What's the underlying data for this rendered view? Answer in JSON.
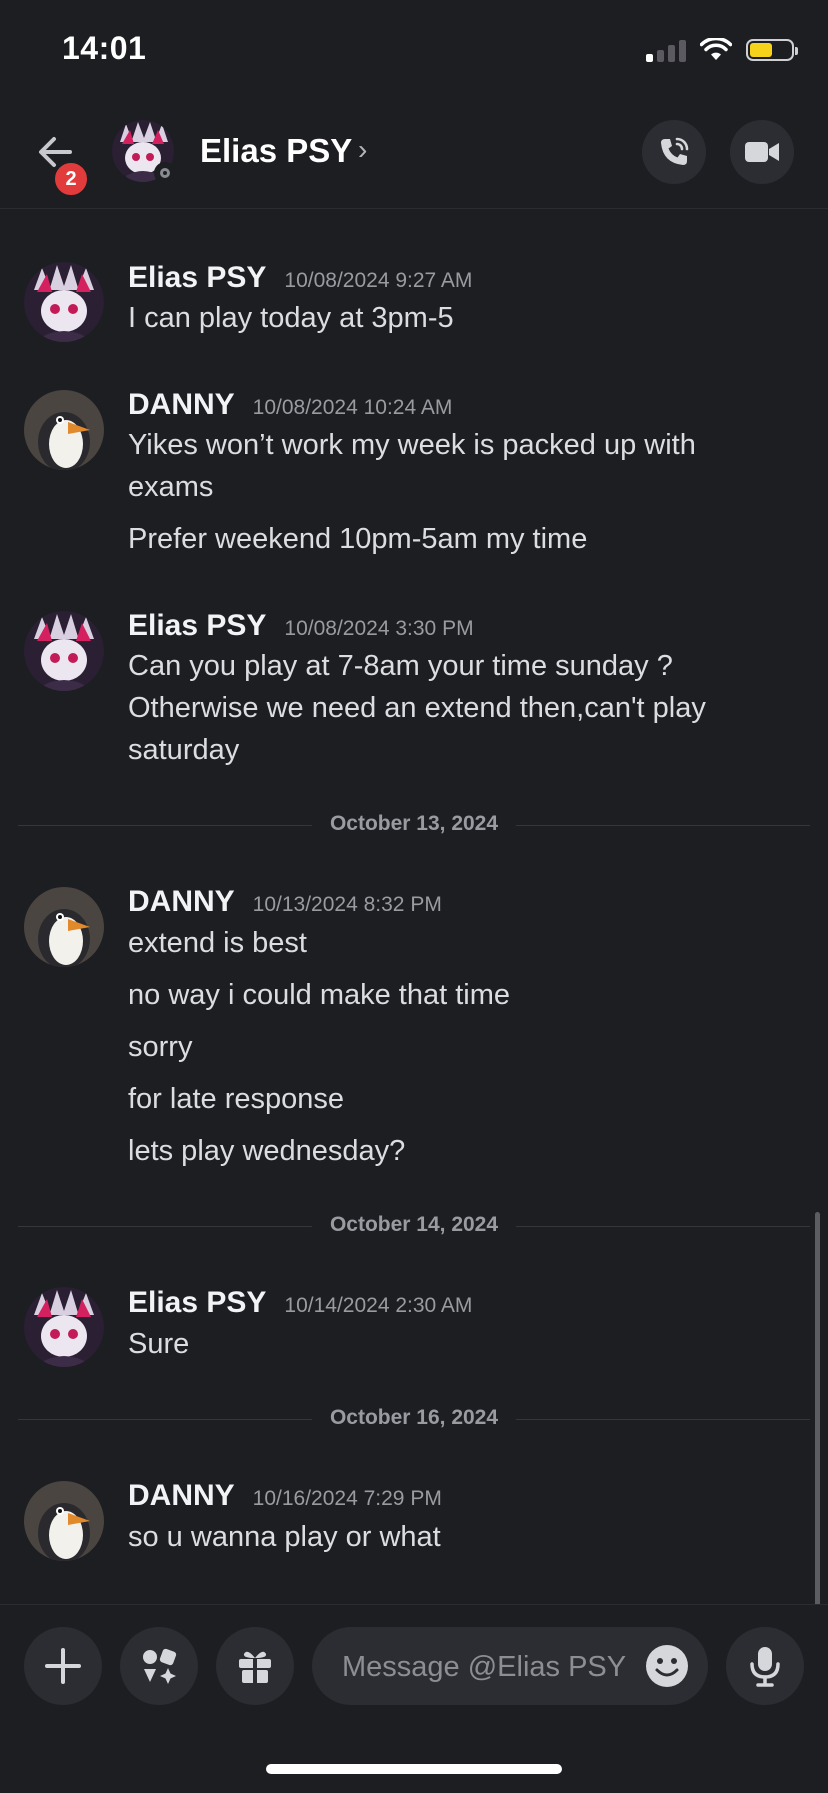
{
  "status_bar": {
    "time": "14:01"
  },
  "header": {
    "name": "Elias PSY",
    "badge_count": "2",
    "chevron": "›"
  },
  "messages": [
    {
      "user": "Elias PSY",
      "timestamp": "10/08/2024 9:27 AM",
      "lines": [
        "I can play today at 3pm-5"
      ]
    },
    {
      "user": "DANNY",
      "timestamp": "10/08/2024 10:24 AM",
      "lines": [
        "Yikes won’t work my week is packed up with",
        "exams",
        "Prefer weekend 10pm-5am my time"
      ]
    },
    {
      "user": "Elias PSY",
      "timestamp": "10/08/2024 3:30 PM",
      "lines": [
        "Can you play at 7-8am your time sunday ?",
        "Otherwise we  need an extend then,can't play",
        "saturday"
      ]
    },
    {
      "user": "DANNY",
      "timestamp": "10/13/2024 8:32 PM",
      "lines": [
        "extend is best",
        "no way i could make that time",
        "sorry",
        "for late response",
        "lets play wednesday?"
      ]
    },
    {
      "user": "Elias PSY",
      "timestamp": "10/14/2024 2:30 AM",
      "lines": [
        "Sure"
      ]
    },
    {
      "user": "DANNY",
      "timestamp": "10/16/2024 7:29 PM",
      "lines": [
        "so u wanna play or what"
      ]
    }
  ],
  "dividers": [
    "October 13, 2024",
    "October 14, 2024",
    "October 16, 2024"
  ],
  "composer": {
    "placeholder": "Message @Elias PSY"
  },
  "colors": {
    "background": "#1d1e22",
    "button_bg": "#2b2d33",
    "badge": "#e23b3b",
    "battery": "#f6d21a"
  }
}
